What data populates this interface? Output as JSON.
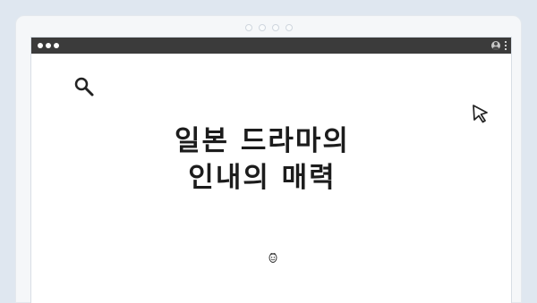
{
  "page": {
    "background_color": "#dfe7f0",
    "frame_color": "#f5f7f9"
  },
  "browser": {
    "titlebar_color": "#3b3b3b",
    "content_color": "#ffffff",
    "window_controls": [
      "circle",
      "circle",
      "circle"
    ],
    "profile_icon": "profile-icon",
    "menu_icon": "kebab-menu-icon"
  },
  "content": {
    "headline_line1": "일본 드라마의",
    "headline_line2": "인내의 매력",
    "search_icon": "search-icon",
    "cursor_icon": "cursor-icon",
    "bottom_icon": "smile-icon"
  }
}
